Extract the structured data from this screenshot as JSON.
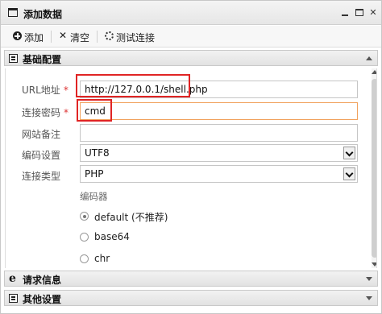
{
  "window": {
    "title": "添加数据"
  },
  "toolbar": {
    "add_label": "添加",
    "clear_label": "清空",
    "test_label": "测试连接"
  },
  "sections": {
    "basic": "基础配置",
    "request": "请求信息",
    "other": "其他设置"
  },
  "form": {
    "url_label": "URL地址",
    "url_value": "http://127.0.0.1/shell.php",
    "password_label": "连接密码",
    "password_value": "cmd",
    "note_label": "网站备注",
    "note_value": "",
    "encoding_label": "编码设置",
    "encoding_value": "UTF8",
    "type_label": "连接类型",
    "type_value": "PHP",
    "encoder_label": "编码器",
    "required_mark": "*",
    "encoders": [
      "default (不推荐)",
      "base64",
      "chr"
    ],
    "selected_encoder": "default (不推荐)"
  },
  "colors": {
    "highlight": "#e02424",
    "focus_border": "#f1a25e",
    "required": "#dd3333"
  }
}
